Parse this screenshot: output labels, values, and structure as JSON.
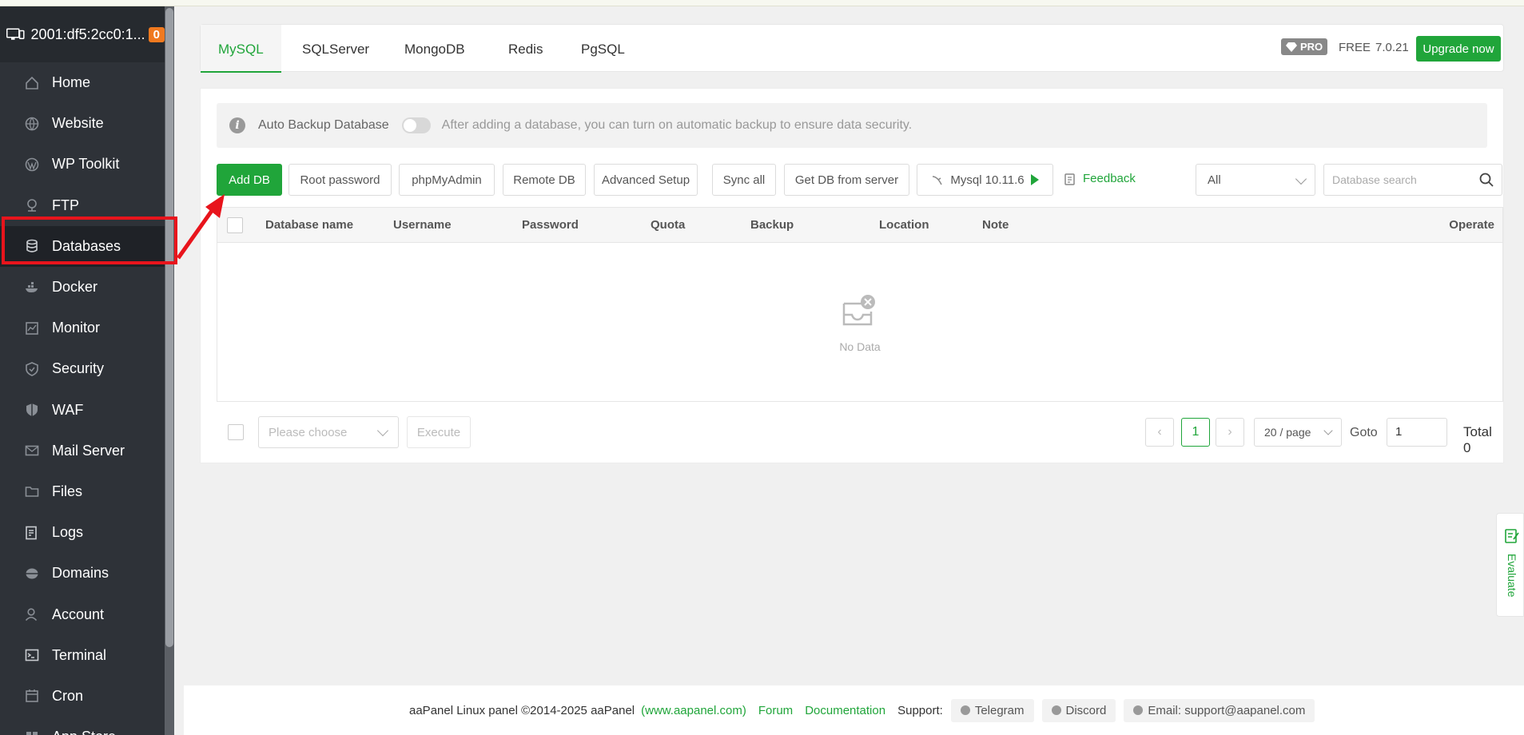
{
  "server": {
    "ip": "2001:df5:2cc0:1...",
    "badge": "0"
  },
  "sidebar": {
    "items": [
      {
        "label": "Home",
        "icon": "home-icon"
      },
      {
        "label": "Website",
        "icon": "globe-icon"
      },
      {
        "label": "WP Toolkit",
        "icon": "wordpress-icon"
      },
      {
        "label": "FTP",
        "icon": "ftp-icon"
      },
      {
        "label": "Databases",
        "icon": "database-icon"
      },
      {
        "label": "Docker",
        "icon": "docker-icon"
      },
      {
        "label": "Monitor",
        "icon": "monitor-icon"
      },
      {
        "label": "Security",
        "icon": "shield-icon"
      },
      {
        "label": "WAF",
        "icon": "waf-shield-icon"
      },
      {
        "label": "Mail Server",
        "icon": "mail-icon"
      },
      {
        "label": "Files",
        "icon": "folder-icon"
      },
      {
        "label": "Logs",
        "icon": "logs-icon"
      },
      {
        "label": "Domains",
        "icon": "domains-icon"
      },
      {
        "label": "Account",
        "icon": "user-icon"
      },
      {
        "label": "Terminal",
        "icon": "terminal-icon"
      },
      {
        "label": "Cron",
        "icon": "calendar-icon"
      },
      {
        "label": "App Store",
        "icon": "apps-icon"
      }
    ]
  },
  "tabs": {
    "items": [
      "MySQL",
      "SQLServer",
      "MongoDB",
      "Redis",
      "PgSQL"
    ],
    "active": "MySQL"
  },
  "edition": {
    "pro": "PRO",
    "free": "FREE",
    "version": "7.0.21",
    "upgrade": "Upgrade now"
  },
  "notice": {
    "label": "Auto Backup Database",
    "tip": "After adding a database, you can turn on automatic backup to ensure data security.",
    "enabled": false
  },
  "toolbar": {
    "add_db": "Add DB",
    "root_password": "Root password",
    "phpmyadmin": "phpMyAdmin",
    "remote_db": "Remote DB",
    "advanced_setup": "Advanced Setup",
    "sync_all": "Sync all",
    "get_db": "Get DB from server",
    "mysql_version": "Mysql 10.11.6",
    "feedback": "Feedback",
    "filter_value": "All",
    "search_placeholder": "Database search"
  },
  "table": {
    "columns": [
      "Database name",
      "Username",
      "Password",
      "Quota",
      "Backup",
      "Location",
      "Note",
      "Operate"
    ],
    "rows": [],
    "empty_text": "No Data"
  },
  "bulk": {
    "placeholder": "Please choose",
    "execute": "Execute"
  },
  "pagination": {
    "current": "1",
    "per_page": "20 / page",
    "goto_label": "Goto",
    "goto_value": "1",
    "total": "Total 0"
  },
  "footer": {
    "copyright": "aaPanel Linux panel ©2014-2025 aaPanel",
    "site": "(www.aapanel.com)",
    "forum": "Forum",
    "docs": "Documentation",
    "support_label": "Support:",
    "telegram": "Telegram",
    "discord": "Discord",
    "email": "Email: support@aapanel.com"
  },
  "evaluate": "Evaluate",
  "colors": {
    "accent": "#20a53a",
    "sidebar_bg": "#2e3238",
    "highlight": "#e8141c",
    "badge": "#f0791f"
  }
}
